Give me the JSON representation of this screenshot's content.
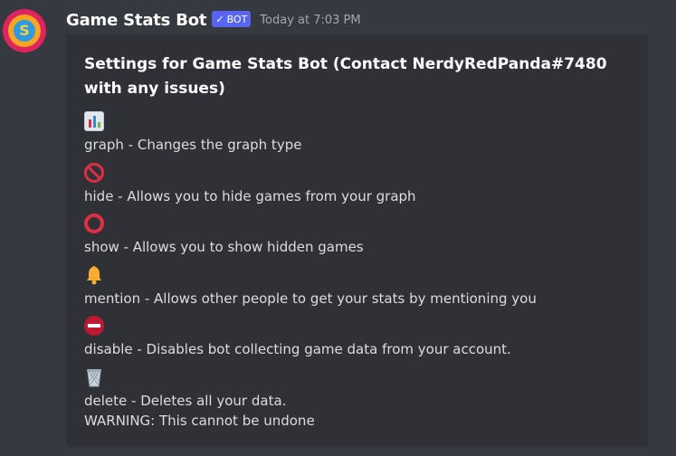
{
  "message": {
    "author": "Game Stats Bot",
    "bot_tag": "BOT",
    "timestamp": "Today at 7:03 PM"
  },
  "embed": {
    "title": "Settings for Game Stats Bot (Contact NerdyRedPanda#7480 with any issues)",
    "options": [
      {
        "icon": "bar-chart-icon",
        "description": "graph - Changes the graph type"
      },
      {
        "icon": "prohibited-icon",
        "description": "hide - Allows you to hide games from your graph"
      },
      {
        "icon": "hollow-red-circle-icon",
        "description": "show - Allows you to show hidden games"
      },
      {
        "icon": "bell-icon",
        "description": "mention - Allows other people to get your stats by mentioning you"
      },
      {
        "icon": "no-entry-icon",
        "description": "disable - Disables bot collecting game data from your account."
      },
      {
        "icon": "wastebasket-icon",
        "description": "delete - Deletes all your data.",
        "warning": "WARNING: This cannot be undone"
      }
    ]
  },
  "colors": {
    "background": "#36393f",
    "embed_background": "#2f3136",
    "bot_tag": "#5865f2",
    "emoji_red": "#dd2e44"
  }
}
